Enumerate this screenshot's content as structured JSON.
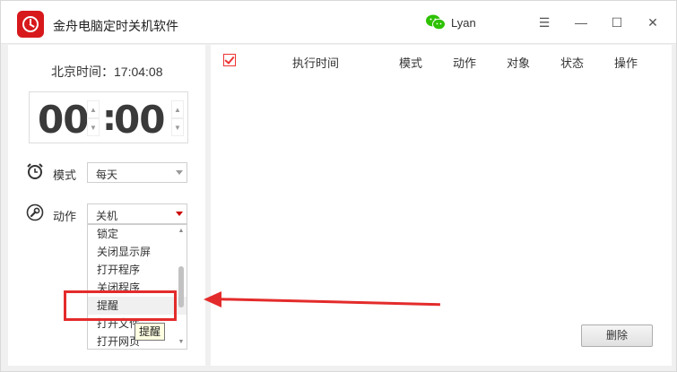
{
  "app": {
    "title": "金舟电脑定时关机软件"
  },
  "account": {
    "user": "Lyan",
    "icon": "wechat-icon"
  },
  "window_controls": {
    "menu": "☰",
    "minimize": "—",
    "maximize": "☐",
    "close": "✕"
  },
  "clock": {
    "label": "北京时间：17:04:08",
    "hour": "00",
    "minute": "00",
    "separator": ":"
  },
  "mode": {
    "label": "模式",
    "value": "每天",
    "icon": "alarm-clock-icon"
  },
  "action": {
    "label": "动作",
    "value": "关机",
    "icon": "wrench-icon"
  },
  "dropdown": {
    "items": [
      "锁定",
      "关闭显示屏",
      "打开程序",
      "关闭程序",
      "提醒",
      "打开文件",
      "打开网页"
    ],
    "hovered": "提醒"
  },
  "tooltip": {
    "text": "提醒"
  },
  "table": {
    "columns": [
      "执行时间",
      "模式",
      "动作",
      "对象",
      "状态",
      "操作"
    ],
    "rows": []
  },
  "buttons": {
    "delete": "删除"
  },
  "colors": {
    "accent": "#e42b2b",
    "logo": "#d7191c",
    "wechat": "#2dc100"
  }
}
